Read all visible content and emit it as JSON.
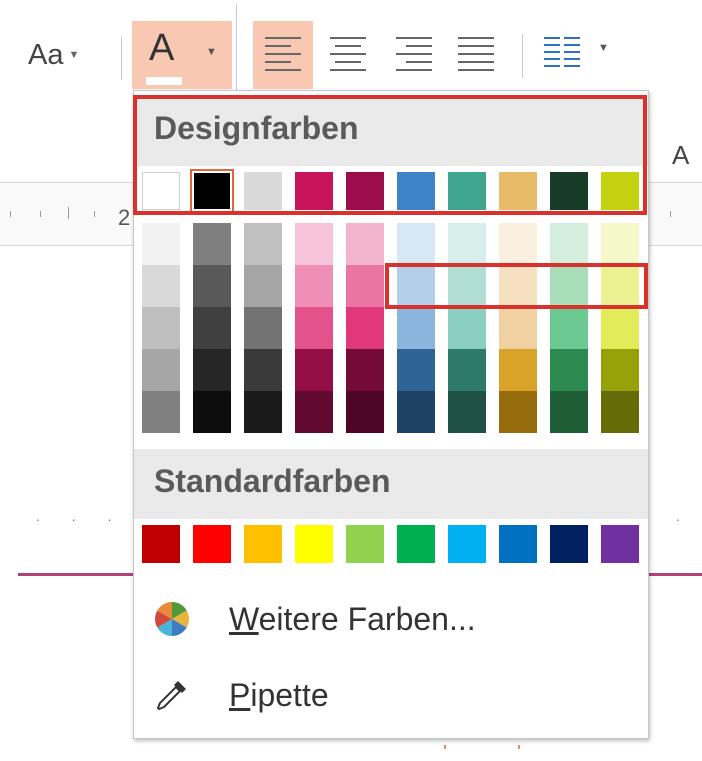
{
  "ribbon": {
    "font_size_label": "Aa",
    "font_color_letter": "A",
    "alignment_buttons": [
      "align-left",
      "align-center",
      "align-right",
      "justify"
    ],
    "columns_button": "columns"
  },
  "background": {
    "ruler_number": "2",
    "side_letter": "A"
  },
  "dropdown": {
    "design_colors_title": "Designfarben",
    "design_colors": [
      "#FFFFFF",
      "#000000",
      "#D9D9D9",
      "#C8145A",
      "#9B0D4B",
      "#3D85C6",
      "#3FA58F",
      "#E8BB6A",
      "#173B27",
      "#C4D10F"
    ],
    "selected_color": "#000000",
    "shades": [
      [
        "#F2F2F2",
        "#D9D9D9",
        "#BFBFBF",
        "#A6A6A6",
        "#808080"
      ],
      [
        "#7F7F7F",
        "#595959",
        "#404040",
        "#262626",
        "#0D0D0D"
      ],
      [
        "#C0C0C0",
        "#A5A5A5",
        "#737373",
        "#3A3A3A",
        "#1A1A1A"
      ],
      [
        "#F6C3D9",
        "#EF8FB5",
        "#E4528C",
        "#930E44",
        "#620930"
      ],
      [
        "#F3B5CE",
        "#EA74A2",
        "#E1387B",
        "#730A37",
        "#4D0625"
      ],
      [
        "#D8E7F4",
        "#B3CEE8",
        "#8AB6DD",
        "#2D6395",
        "#1E4264"
      ],
      [
        "#D7EFEA",
        "#B0DED5",
        "#8BCFC1",
        "#2E7A6A",
        "#1F5147"
      ],
      [
        "#FAF0DF",
        "#F5E1C1",
        "#F0D2A2",
        "#D9A32A",
        "#966C0D"
      ],
      [
        "#D3EEDC",
        "#A8DDB9",
        "#6CC992",
        "#2E8B50",
        "#1E5C35"
      ],
      [
        "#F5F8C8",
        "#ECF291",
        "#E2EB5A",
        "#97A10A",
        "#646B07"
      ]
    ],
    "standard_colors_title": "Standardfarben",
    "standard_colors": [
      "#C00000",
      "#FF0000",
      "#FFC000",
      "#FFFF00",
      "#92D050",
      "#00B050",
      "#00B0F0",
      "#0070C0",
      "#002060",
      "#7030A0"
    ],
    "more_colors_label": "Weitere Farben...",
    "more_colors_underline": "W",
    "more_colors_rest": "eitere Farben...",
    "eyedropper_label": "Pipette",
    "eyedropper_underline": "P",
    "eyedropper_rest": "ipette",
    "highlight_color": "#D9322D"
  }
}
